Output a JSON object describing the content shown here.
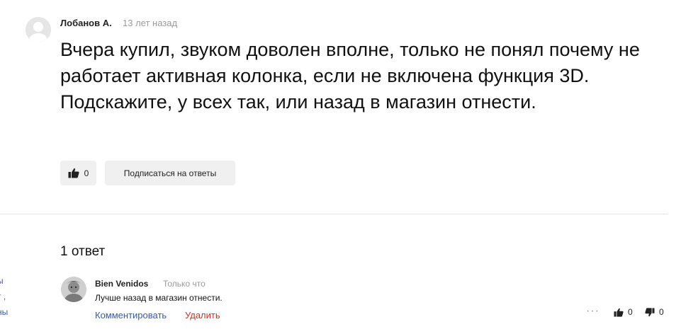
{
  "question": {
    "author": "Лобанов А.",
    "time": "13 лет назад",
    "text": "Вчера купил, звуком доволен вполне, только не понял почему не работает активная колонка, если не включена функция 3D. Подскажите, у всех так, или назад в магазин отнести.",
    "likes": "0",
    "subscribe_label": "Подписаться на ответы"
  },
  "answers_count_label": "1 ответ",
  "edge_fragments": [
    "ы",
    "т ,",
    "ны"
  ],
  "answer": {
    "author": "Bien Venidos",
    "time": "Только что",
    "text": "Лучше назад в магазин отнести.",
    "comment_label": "Комментировать",
    "delete_label": "Удалить",
    "more_label": "···",
    "likes": "0",
    "dislikes": "0"
  },
  "icons": {
    "avatar": "user-avatar-icon",
    "like": "thumbs-up-icon",
    "dislike": "thumbs-down-icon",
    "more": "more-dots-icon"
  }
}
